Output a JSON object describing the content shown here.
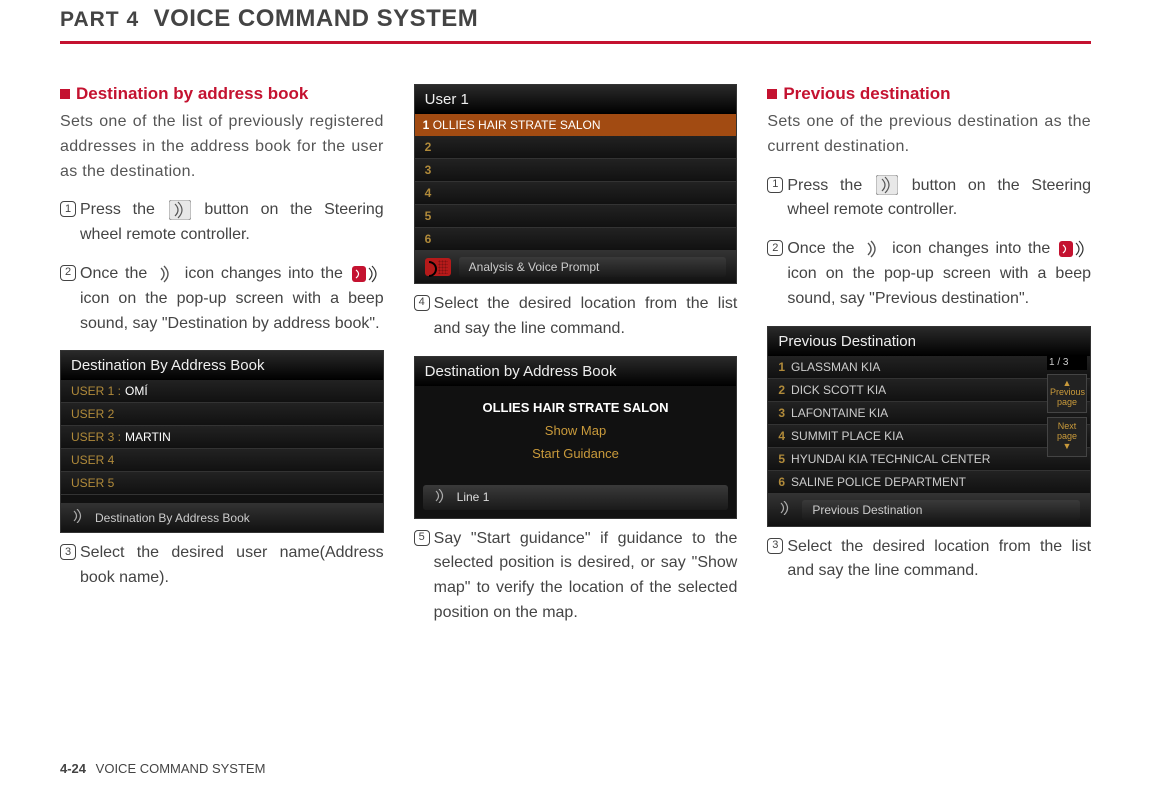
{
  "header": {
    "part": "PART 4",
    "title": "VOICE COMMAND SYSTEM"
  },
  "col1": {
    "heading": "Destination by address book",
    "intro": "Sets one of the list of previously registered addresses in the address book for the user as the destination.",
    "step1_a": "Press the ",
    "step1_b": " button on the Steering wheel remote controller.",
    "step2_a": "Once the ",
    "step2_b": " icon changes into the ",
    "step2_c": " icon on the pop-up screen with a beep sound, say \"Destination by address book\".",
    "shot1": {
      "title": "Destination By Address Book",
      "rows": [
        {
          "label": "USER 1 :",
          "val": "OMÍ"
        },
        {
          "label": "USER 2",
          "val": ""
        },
        {
          "label": "USER 3 :",
          "val": "MARTIN"
        },
        {
          "label": "USER 4",
          "val": ""
        },
        {
          "label": "USER 5",
          "val": ""
        }
      ],
      "footer": "Destination By Address Book"
    },
    "step3": "Select the desired user name(Address book name)."
  },
  "col2": {
    "shot2": {
      "title": "User 1",
      "orangerow": "OLLIES HAIR STRATE SALON",
      "nums": [
        "2",
        "3",
        "4",
        "5",
        "6"
      ],
      "footer": "Analysis & Voice Prompt"
    },
    "step4": "Select the desired location from the list and say the line command.",
    "shot3": {
      "title": "Destination by Address Book",
      "center": "OLLIES HAIR STRATE SALON",
      "opt1": "Show Map",
      "opt2": "Start Guidance",
      "footer": "Line 1"
    },
    "step5": "Say \"Start guidance\" if guidance to the selected position is desired, or say \"Show map\" to verify the location of the selected position on the map."
  },
  "col3": {
    "heading": "Previous destination",
    "intro": "Sets one of the previous destination as the current destination.",
    "step1_a": "Press the ",
    "step1_b": " button on the Steering wheel remote controller.",
    "step2_a": "Once the ",
    "step2_b": " icon changes into the ",
    "step2_c": " icon on the pop-up screen with a beep sound, say \"Previous destination\".",
    "shot4": {
      "title": "Previous Destination",
      "rows": [
        "GLASSMAN KIA",
        "DICK SCOTT KIA",
        "LAFONTAINE KIA",
        "SUMMIT PLACE KIA",
        "HYUNDAI KIA TECHNICAL CENTER",
        "SALINE POLICE DEPARTMENT"
      ],
      "footer": "Previous Destination",
      "page": "1 / 3",
      "prev": "Previous page",
      "next": "Next page"
    },
    "step3": "Select the desired location from the list and say the line command."
  },
  "footer": {
    "pagenum": "4-24",
    "label": "VOICE COMMAND SYSTEM"
  }
}
